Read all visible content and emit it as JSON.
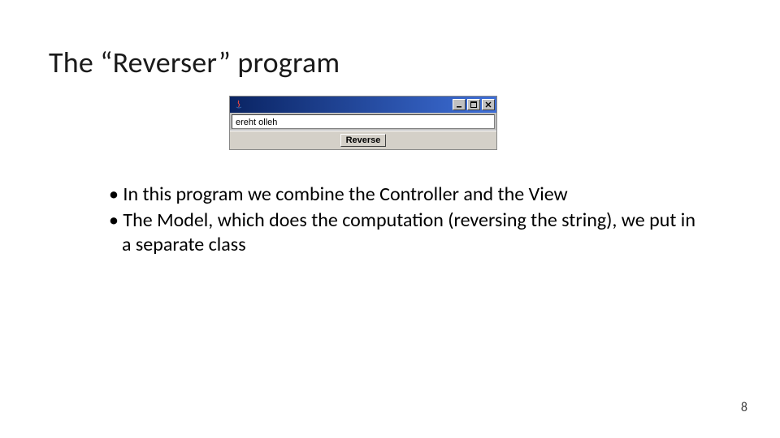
{
  "title": "The “Reverser” program",
  "window": {
    "icon_name": "java-icon",
    "input_value": "ereht olleh",
    "button_label": "Reverse",
    "controls": {
      "minimize": "minimize",
      "maximize": "maximize",
      "close": "close"
    }
  },
  "bullets": [
    "In this program we combine the Controller and the View",
    "The Model, which does the computation (reversing the string), we put in a separate class"
  ],
  "page_number": "8"
}
